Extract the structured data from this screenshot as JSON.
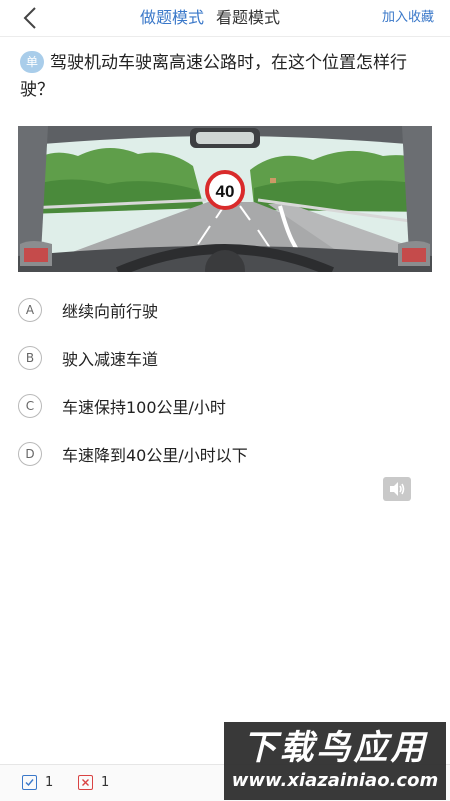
{
  "header": {
    "tabs": [
      {
        "label": "做题模式",
        "active": true
      },
      {
        "label": "看题模式",
        "active": false
      }
    ],
    "collect_label": "加入收藏"
  },
  "question": {
    "type_badge": "单",
    "text": "驾驶机动车驶离高速公路时，在这个位置怎样行驶？"
  },
  "scene": {
    "speed_sign": "40"
  },
  "options": [
    {
      "letter": "A",
      "text": "继续向前行驶"
    },
    {
      "letter": "B",
      "text": "驶入减速车道"
    },
    {
      "letter": "C",
      "text": "车速保持100公里/小时"
    },
    {
      "letter": "D",
      "text": "车速降到40公里/小时以下"
    }
  ],
  "footer": {
    "correct_count": "1",
    "wrong_count": "1"
  },
  "watermark": {
    "title": "下载鸟应用",
    "url": "www.xiazainiao.com"
  },
  "colors": {
    "accent": "#3a78c9",
    "badge": "#a9cdea",
    "wrong": "#d94343"
  }
}
